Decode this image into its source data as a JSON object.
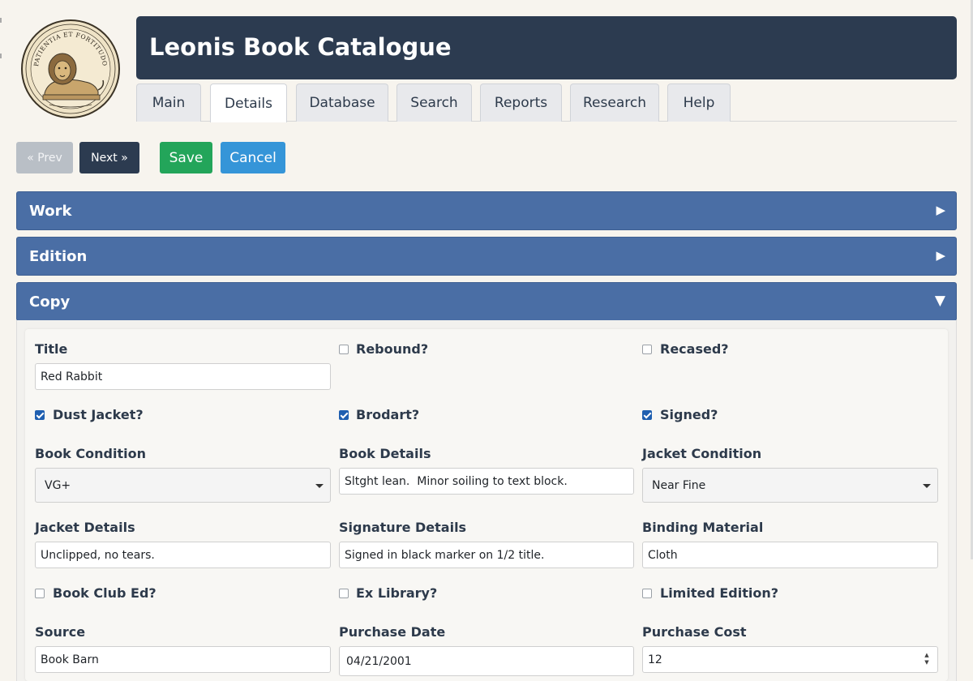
{
  "app": {
    "title": "Leonis Book Catalogue",
    "logo_motto": "PATIENTIA ET FORTITUDO"
  },
  "tabs": [
    {
      "label": "Main",
      "active": false
    },
    {
      "label": "Details",
      "active": true
    },
    {
      "label": "Database",
      "active": false
    },
    {
      "label": "Search",
      "active": false
    },
    {
      "label": "Reports",
      "active": false
    },
    {
      "label": "Research",
      "active": false
    },
    {
      "label": "Help",
      "active": false
    }
  ],
  "toolbar": {
    "prev_label": "« Prev",
    "next_label": "Next »",
    "save_label": "Save",
    "cancel_label": "Cancel"
  },
  "panels": {
    "work": {
      "title": "Work",
      "expanded": false,
      "arrow": "▶"
    },
    "edition": {
      "title": "Edition",
      "expanded": false,
      "arrow": "▶"
    },
    "copy": {
      "title": "Copy",
      "expanded": true,
      "arrow": "▼"
    }
  },
  "copy": {
    "title": {
      "label": "Title",
      "value": "Red Rabbit"
    },
    "rebound": {
      "label": "Rebound?",
      "checked": false
    },
    "recased": {
      "label": "Recased?",
      "checked": false
    },
    "dust_jacket": {
      "label": "Dust Jacket?",
      "checked": true
    },
    "brodart": {
      "label": "Brodart?",
      "checked": true
    },
    "signed": {
      "label": "Signed?",
      "checked": true
    },
    "book_condition": {
      "label": "Book Condition",
      "value": "VG+"
    },
    "book_details": {
      "label": "Book Details",
      "value": "Sltght lean.  Minor soiling to text block."
    },
    "jacket_condition": {
      "label": "Jacket Condition",
      "value": "Near Fine"
    },
    "jacket_details": {
      "label": "Jacket Details",
      "value": "Unclipped, no tears."
    },
    "signature_details": {
      "label": "Signature Details",
      "value": "Signed in black marker on 1/2 title."
    },
    "binding_material": {
      "label": "Binding Material",
      "value": "Cloth"
    },
    "book_club_ed": {
      "label": "Book Club Ed?",
      "checked": false
    },
    "ex_library": {
      "label": "Ex Library?",
      "checked": false
    },
    "limited_edition": {
      "label": "Limited Edition?",
      "checked": false
    },
    "source": {
      "label": "Source",
      "value": "Book Barn"
    },
    "purchase_date": {
      "label": "Purchase Date",
      "value": "04/21/2001"
    },
    "purchase_cost": {
      "label": "Purchase Cost",
      "value": "12"
    }
  },
  "colors": {
    "header_bg": "#2c3b50",
    "panel_bg": "#4a6ea5",
    "save": "#23a55a",
    "cancel": "#3595d8",
    "checkbox": "#1f5fb0"
  }
}
